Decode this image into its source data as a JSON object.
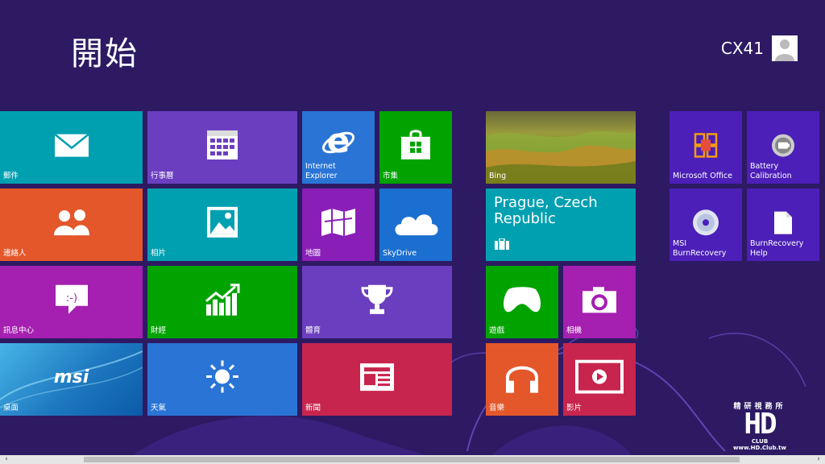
{
  "header": {
    "title": "開始",
    "user_name": "CX41"
  },
  "tiles": {
    "mail": {
      "label": "郵件",
      "color": "#00a0b1"
    },
    "calendar": {
      "label": "行事曆",
      "color": "#6b3ec0"
    },
    "ie": {
      "label": "Internet\nExplorer",
      "color": "#2a74d6"
    },
    "store": {
      "label": "市集",
      "color": "#00a300"
    },
    "people": {
      "label": "連絡人",
      "color": "#e3572b"
    },
    "photos": {
      "label": "相片",
      "color": "#00a0b1"
    },
    "maps": {
      "label": "地圖",
      "color": "#8a1fb8"
    },
    "skydrive": {
      "label": "SkyDrive",
      "color": "#1b6fd0"
    },
    "messaging": {
      "label": "訊息中心",
      "color": "#a51fb0"
    },
    "finance": {
      "label": "財經",
      "color": "#00a300"
    },
    "sports": {
      "label": "體育",
      "color": "#6b3ec0"
    },
    "desktop": {
      "label": "桌面",
      "color": "#1e8cc8",
      "brand": "msi"
    },
    "weather": {
      "label": "天氣",
      "color": "#2a74d6"
    },
    "news": {
      "label": "新聞",
      "color": "#c7254d"
    },
    "bing": {
      "label": "Bing"
    },
    "travel": {
      "label": "Prague, Czech\nRepublic",
      "color": "#00a0b1"
    },
    "games": {
      "label": "遊戲",
      "color": "#00a300"
    },
    "camera": {
      "label": "相機",
      "color": "#a51fb0"
    },
    "music": {
      "label": "音樂",
      "color": "#e3572b"
    },
    "video": {
      "label": "影片",
      "color": "#c7254d"
    },
    "office": {
      "label": "Microsoft Office",
      "color": "#4b1fb8"
    },
    "battery": {
      "label": "Battery\nCalibration",
      "color": "#4b1fb8"
    },
    "msi_burn": {
      "label": "MSI\nBurnRecovery",
      "color": "#4b1fb8"
    },
    "burn_help": {
      "label": "BurnRecovery\nHelp",
      "color": "#4b1fb8"
    }
  },
  "watermark": {
    "top": "精研視務所",
    "logo": "HD",
    "sub": "CLUB",
    "url": "www.HD.Club.tw"
  },
  "scrollbar": {
    "left_arrow": "‹",
    "right_arrow": "›"
  }
}
